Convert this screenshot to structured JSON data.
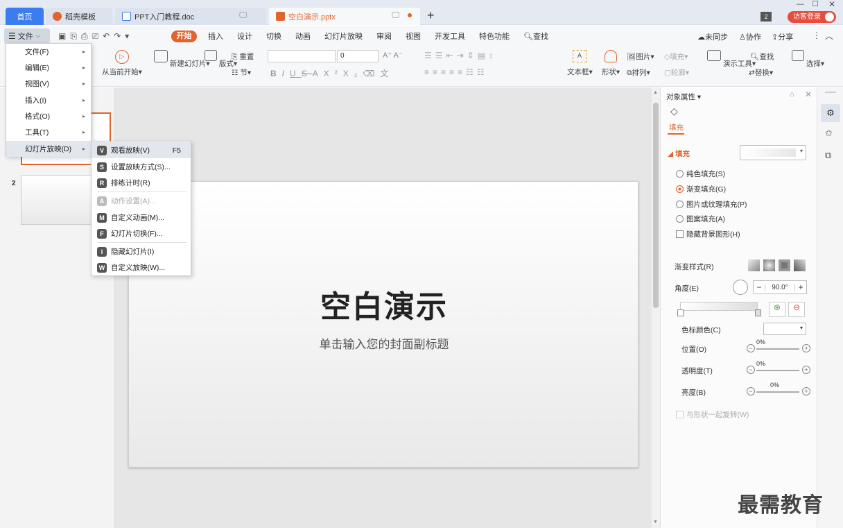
{
  "tabs": {
    "home": "首页",
    "template": "稻壳模板",
    "doc": "PPT入门教程.doc",
    "active": "空白演示.pptx",
    "visitor": "访客登录",
    "page_count": "2"
  },
  "menubar": {
    "file": "文件",
    "start": "开始",
    "items": [
      "插入",
      "设计",
      "切换",
      "动画",
      "幻灯片放映",
      "审阅",
      "视图",
      "开发工具",
      "特色功能"
    ],
    "search": "查找",
    "sync": "未同步",
    "collab": "协作",
    "share": "分享"
  },
  "ribbon": {
    "from_current": "从当前开始",
    "new_slide": "新建幻灯片",
    "layout": "版式",
    "reset": "重置",
    "section": "节",
    "font_size": "0",
    "textbox": "文本框",
    "shape": "形状",
    "picture": "图片",
    "fill": "填充",
    "arrange": "排列",
    "outline": "轮廓",
    "present_tools": "演示工具",
    "find": "查找",
    "replace": "替换",
    "select": "选择"
  },
  "file_menu": {
    "items": [
      "文件(F)",
      "编辑(E)",
      "视图(V)",
      "插入(I)",
      "格式(O)",
      "工具(T)",
      "幻灯片放映(D)"
    ]
  },
  "slideshow_menu": {
    "items": [
      {
        "key": "V",
        "label": "观看放映(V)",
        "shortcut": "F5"
      },
      {
        "key": "S",
        "label": "设置放映方式(S)..."
      },
      {
        "key": "R",
        "label": "排练计时(R)"
      },
      {
        "key": "A",
        "label": "动作设置(A)..."
      },
      {
        "key": "M",
        "label": "自定义动画(M)..."
      },
      {
        "key": "F",
        "label": "幻灯片切换(F)..."
      },
      {
        "key": "I",
        "label": "隐藏幻灯片(I)"
      },
      {
        "key": "W",
        "label": "自定义放映(W)..."
      }
    ]
  },
  "thumbnails": {
    "slide2_number": "2"
  },
  "slide": {
    "title": "空白演示",
    "subtitle": "单击输入您的封面副标题"
  },
  "props": {
    "header": "对象属性",
    "tab_fill": "填充",
    "section_fill": "填充",
    "options": [
      "纯色填充(S)",
      "渐变填充(G)",
      "图片或纹理填充(P)",
      "图案填充(A)"
    ],
    "hide_bg": "隐藏背景图形(H)",
    "gradient_style": "渐变样式(R)",
    "angle_label": "角度(E)",
    "angle_value": "90.0°",
    "stop_color": "色标颜色(C)",
    "position": "位置(O)",
    "position_value": "0%",
    "transparency": "透明度(T)",
    "transparency_value": "0%",
    "brightness": "亮度(B)",
    "brightness_value": "0%",
    "rotate_with_shape": "与形状一起旋转(W)"
  },
  "watermark": "最需教育",
  "colors": {
    "accent": "#e0642b",
    "home_tab": "#3b7cf0"
  }
}
